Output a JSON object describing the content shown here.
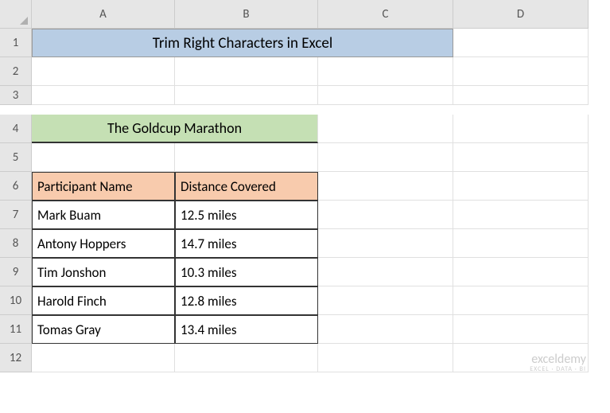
{
  "columns": [
    "A",
    "B",
    "C",
    "D"
  ],
  "rows": [
    "1",
    "2",
    "3",
    "4",
    "5",
    "6",
    "7",
    "8",
    "9",
    "10",
    "11",
    "12"
  ],
  "title": "Trim Right Characters in Excel",
  "subtitle": "The Goldcup Marathon",
  "table": {
    "headers": [
      "Participant Name",
      "Distance Covered"
    ],
    "data": [
      [
        "Mark Buam",
        "12.5 miles"
      ],
      [
        "Antony Hoppers",
        "14.7 miles"
      ],
      [
        "Tim Jonshon",
        "10.3 miles"
      ],
      [
        "Harold Finch",
        "12.8 miles"
      ],
      [
        "Tomas Gray",
        "13.4 miles"
      ]
    ]
  },
  "watermark": {
    "main": "exceldemy",
    "sub": "EXCEL · DATA · BI"
  },
  "chart_data": {
    "type": "table",
    "title": "The Goldcup Marathon",
    "columns": [
      "Participant Name",
      "Distance Covered"
    ],
    "rows": [
      {
        "Participant Name": "Mark Buam",
        "Distance Covered": "12.5 miles"
      },
      {
        "Participant Name": "Antony Hoppers",
        "Distance Covered": "14.7 miles"
      },
      {
        "Participant Name": "Tim Jonshon",
        "Distance Covered": "10.3 miles"
      },
      {
        "Participant Name": "Harold Finch",
        "Distance Covered": "12.8 miles"
      },
      {
        "Participant Name": "Tomas Gray",
        "Distance Covered": "13.4 miles"
      }
    ]
  }
}
